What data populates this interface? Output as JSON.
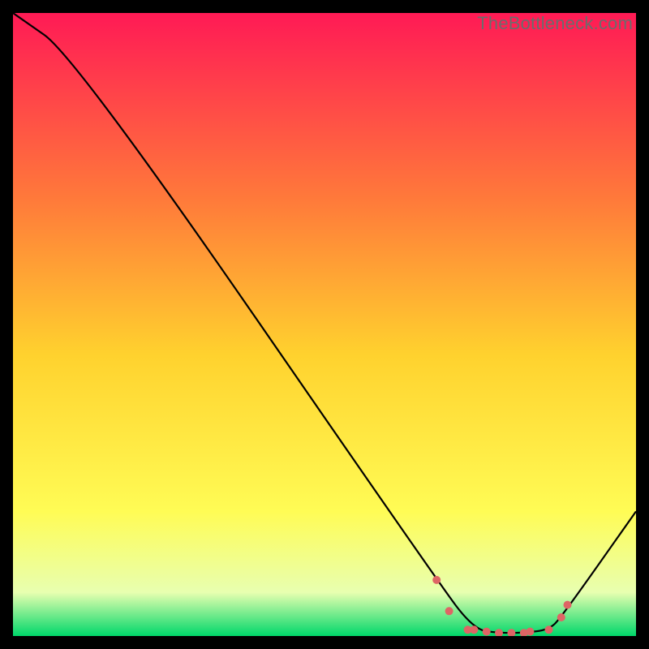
{
  "watermark": "TheBottleneck.com",
  "colors": {
    "black": "#000000",
    "line": "#000000",
    "marker": "#de6565",
    "grad_top": "#ff1a55",
    "grad_mid1": "#ff7a3a",
    "grad_mid2": "#ffd22e",
    "grad_mid3": "#fffc55",
    "grad_mid4": "#e8ffb0",
    "grad_bottom": "#00d76a"
  },
  "chart_data": {
    "type": "line",
    "title": "",
    "xlabel": "",
    "ylabel": "",
    "xlim": [
      0,
      100
    ],
    "ylim": [
      0,
      100
    ],
    "series": [
      {
        "name": "curve",
        "x": [
          0,
          10,
          68,
          74,
          78,
          82,
          86,
          88,
          100
        ],
        "y": [
          100,
          93,
          9,
          1,
          0.5,
          0.5,
          1,
          3,
          20
        ]
      }
    ],
    "markers": {
      "name": "flat-region-points",
      "x": [
        68,
        70,
        73,
        74,
        76,
        78,
        80,
        82,
        83,
        86,
        88,
        89
      ],
      "y": [
        9,
        4,
        1,
        1,
        0.7,
        0.5,
        0.5,
        0.5,
        0.7,
        1,
        3,
        5
      ]
    },
    "gradient_stops": [
      {
        "offset": 0.0,
        "color": "#ff1a55"
      },
      {
        "offset": 0.3,
        "color": "#ff7a3a"
      },
      {
        "offset": 0.55,
        "color": "#ffd22e"
      },
      {
        "offset": 0.8,
        "color": "#fffc55"
      },
      {
        "offset": 0.93,
        "color": "#e8ffb0"
      },
      {
        "offset": 1.0,
        "color": "#00d76a"
      }
    ]
  }
}
